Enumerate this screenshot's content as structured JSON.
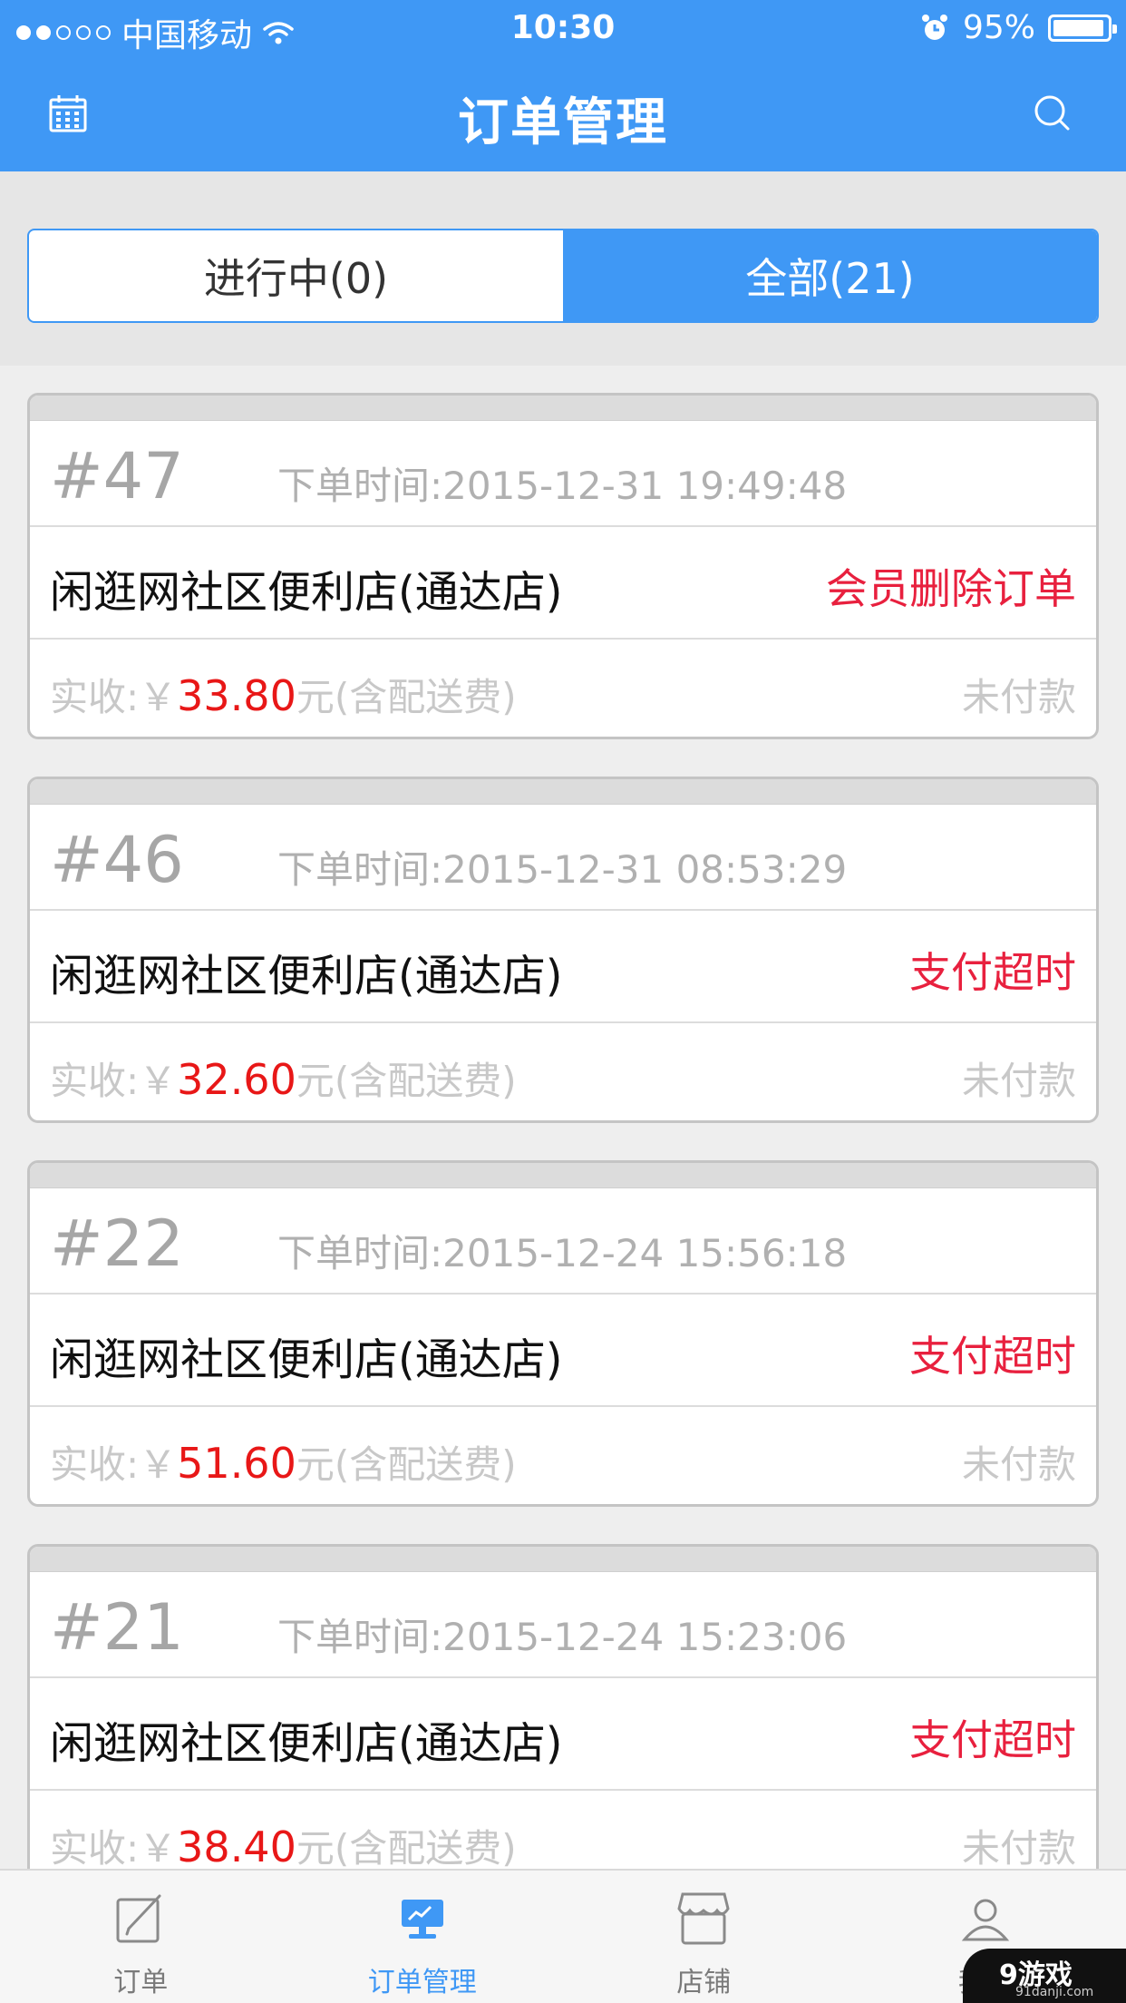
{
  "statusbar": {
    "carrier": "中国移动",
    "time": "10:30",
    "battery": "95%",
    "battery_level": 0.95
  },
  "header": {
    "title": "订单管理",
    "left_icon": "calendar-icon",
    "right_icon": "search-icon"
  },
  "segment": {
    "tabs": [
      {
        "label": "进行中(0)",
        "active": false
      },
      {
        "label": "全部(21)",
        "active": true
      }
    ]
  },
  "orders": [
    {
      "number": "#47",
      "time": "下单时间:2015-12-31 19:49:48",
      "shop": "闲逛网社区便利店(通达店)",
      "status": "会员删除订单",
      "pay_prefix": "实收:￥",
      "amount": "33.80",
      "pay_suffix": "元(含配送费)",
      "pay_state": "未付款"
    },
    {
      "number": "#46",
      "time": "下单时间:2015-12-31 08:53:29",
      "shop": "闲逛网社区便利店(通达店)",
      "status": "支付超时",
      "pay_prefix": "实收:￥",
      "amount": "32.60",
      "pay_suffix": "元(含配送费)",
      "pay_state": "未付款"
    },
    {
      "number": "#22",
      "time": "下单时间:2015-12-24 15:56:18",
      "shop": "闲逛网社区便利店(通达店)",
      "status": "支付超时",
      "pay_prefix": "实收:￥",
      "amount": "51.60",
      "pay_suffix": "元(含配送费)",
      "pay_state": "未付款"
    },
    {
      "number": "#21",
      "time": "下单时间:2015-12-24 15:23:06",
      "shop": "闲逛网社区便利店(通达店)",
      "status": "支付超时",
      "pay_prefix": "实收:￥",
      "amount": "38.40",
      "pay_suffix": "元(含配送费)",
      "pay_state": "未付款"
    }
  ],
  "tabbar": {
    "items": [
      {
        "label": "订单",
        "icon": "edit-icon",
        "active": false
      },
      {
        "label": "订单管理",
        "icon": "monitor-icon",
        "active": true
      },
      {
        "label": "店铺",
        "icon": "store-icon",
        "active": false
      },
      {
        "label": "我的",
        "icon": "user-icon",
        "active": false
      }
    ]
  },
  "watermark": {
    "main": "9游戏",
    "sub": "91danji.com"
  },
  "colors": {
    "accent": "#3f98f5",
    "status_red": "#e8203e",
    "amount_red": "#e81717"
  }
}
